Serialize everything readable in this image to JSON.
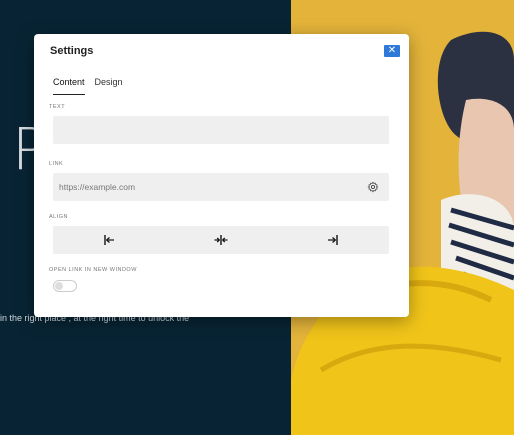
{
  "background": {
    "heading": "P",
    "tagline": "in the right place , at the right time to unlock the"
  },
  "modal": {
    "title": "Settings",
    "close_label": "✕",
    "tabs": [
      {
        "label": "Content",
        "active": true
      },
      {
        "label": "Design",
        "active": false
      }
    ],
    "fields": {
      "text": {
        "label": "TEXT",
        "value": ""
      },
      "link": {
        "label": "LINK",
        "placeholder": "https://example.com",
        "value": ""
      },
      "align": {
        "label": "ALIGN",
        "options": [
          "left",
          "center",
          "right"
        ]
      },
      "open_new_window": {
        "label": "OPEN LINK IN NEW WINDOW",
        "enabled": false
      }
    }
  },
  "colors": {
    "accent": "#2f7ad8",
    "dark_bg": "#082434",
    "yellow_bg": "#e6b63a"
  }
}
